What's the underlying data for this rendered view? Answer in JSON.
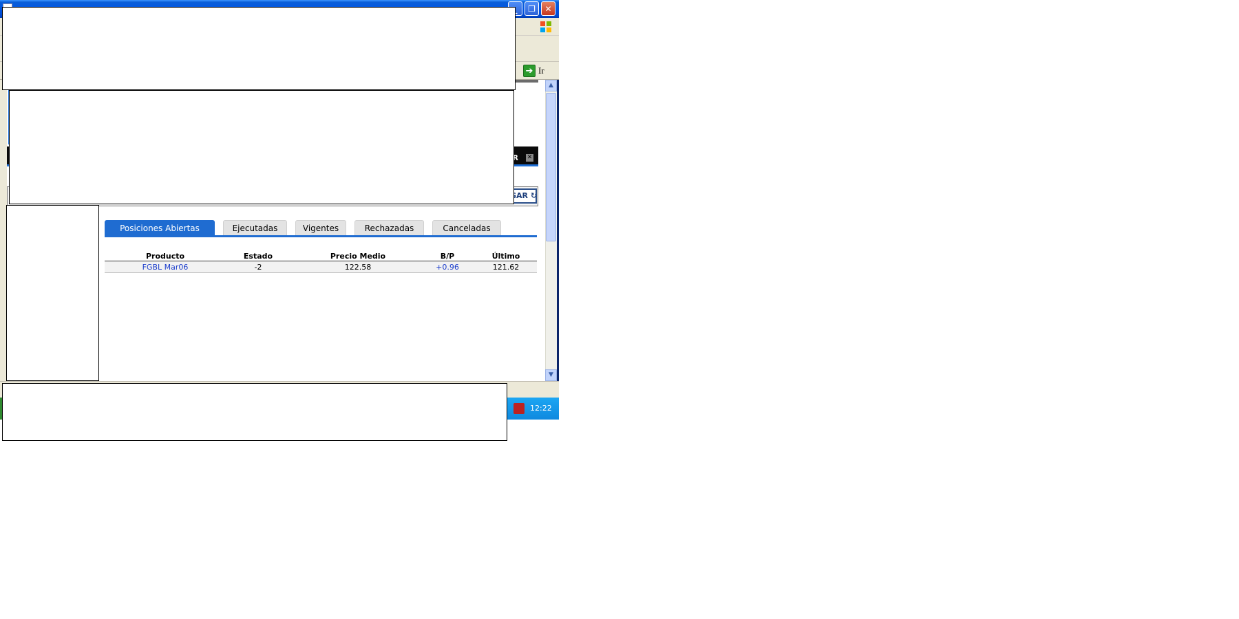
{
  "window": {
    "tab_bar_left_label": "",
    "go_label": "Ir",
    "close_panel_label": "AR",
    "refresh_label": "GAR"
  },
  "tabs": [
    {
      "label": "Posiciones Abiertas",
      "active": true
    },
    {
      "label": "Ejecutadas",
      "active": false
    },
    {
      "label": "Vigentes",
      "active": false
    },
    {
      "label": "Rechazadas",
      "active": false
    },
    {
      "label": "Canceladas",
      "active": false
    }
  ],
  "table": {
    "headers": [
      "Producto",
      "Estado",
      "Precio Medio",
      "B/P",
      "Último"
    ],
    "rows": [
      [
        "FGBL Mar06",
        "-2",
        "122.58",
        "+0.96",
        "121.62"
      ]
    ]
  },
  "taskbar": {
    "clock": "12:22"
  },
  "colors": {
    "accent": "#1f6cd1",
    "link": "#1a3ccc",
    "titlebar": "#0054e3"
  },
  "icons": {
    "go": "arrow-right-icon",
    "close": "close-icon",
    "refresh": "refresh-icon"
  }
}
